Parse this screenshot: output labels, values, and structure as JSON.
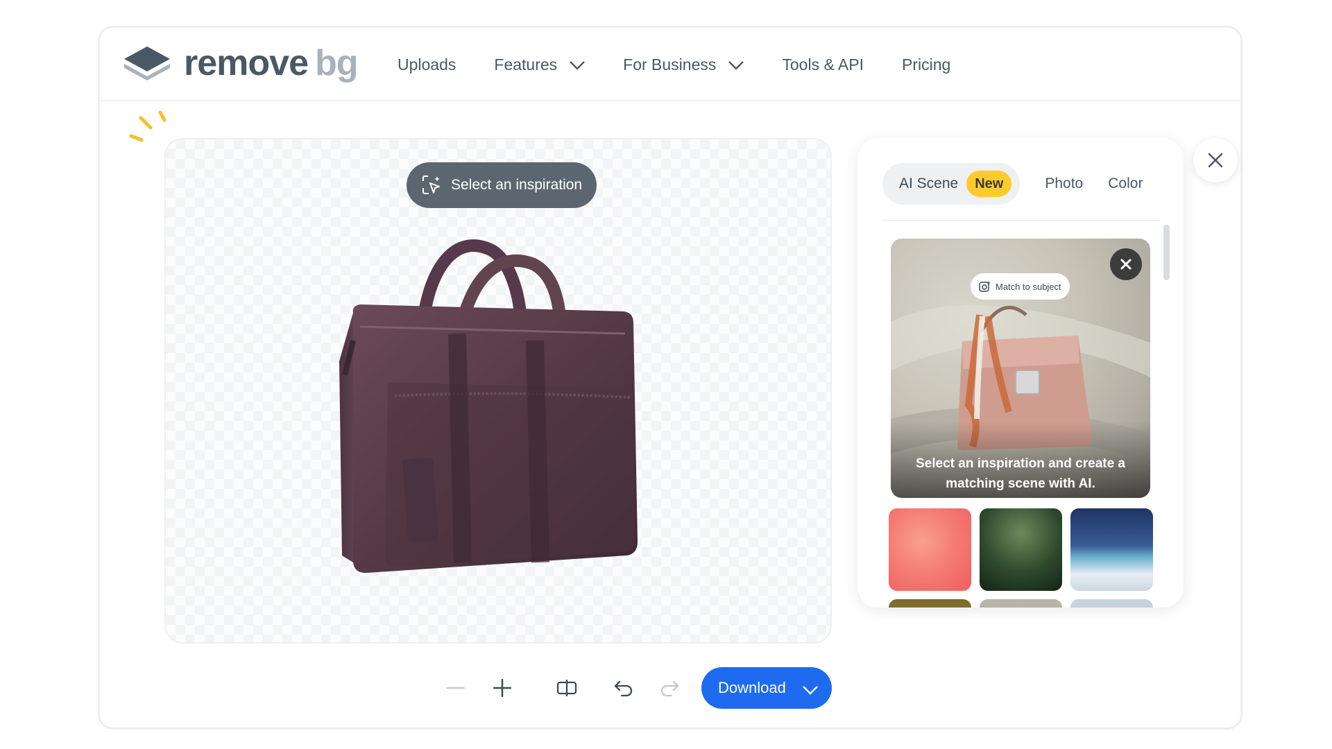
{
  "app": {
    "logo_primary": "remove",
    "logo_secondary": "bg"
  },
  "nav": {
    "items": [
      {
        "label": "Uploads",
        "has_dropdown": false
      },
      {
        "label": "Features",
        "has_dropdown": true
      },
      {
        "label": "For Business",
        "has_dropdown": true
      },
      {
        "label": "Tools & API",
        "has_dropdown": false
      },
      {
        "label": "Pricing",
        "has_dropdown": false
      }
    ]
  },
  "canvas": {
    "inspiration_button": "Select an inspiration",
    "subject": "leather-laptop-bag-image"
  },
  "panel": {
    "tabs": [
      {
        "label": "AI Scene",
        "badge": "New",
        "active": true
      },
      {
        "label": "Photo",
        "active": false
      },
      {
        "label": "Color",
        "active": false
      }
    ],
    "hero": {
      "chip_label": "Match to subject",
      "caption": "Select an inspiration and create a matching scene with AI."
    },
    "thumbnails": [
      "pink-clouds-thumbnail",
      "green-foliage-thumbnail",
      "ice-iceberg-thumbnail",
      "sunset-tree-thumbnail",
      "grey-stone-thumbnail",
      "window-interior-thumbnail"
    ]
  },
  "toolbar": {
    "download_label": "Download"
  },
  "colors": {
    "accent": "#1e6bf0",
    "badge": "#ffcb2c",
    "pill": "#5c6670",
    "text": "#4a5866"
  }
}
